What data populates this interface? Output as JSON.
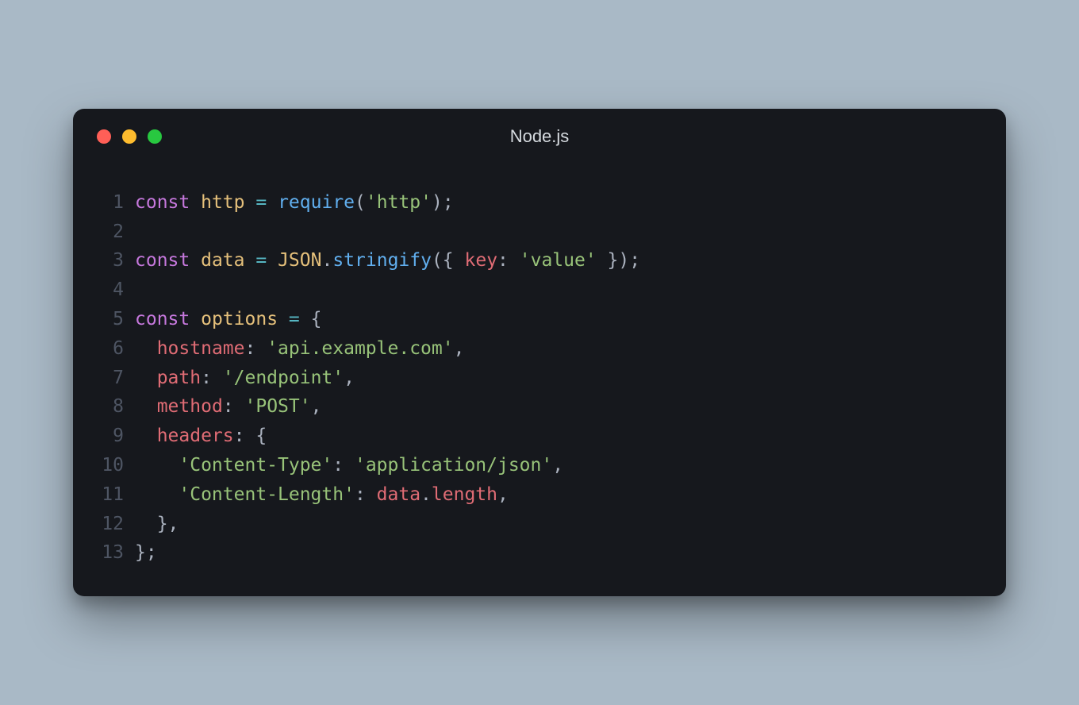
{
  "window": {
    "title": "Node.js",
    "traffic_lights": [
      "red",
      "yellow",
      "green"
    ]
  },
  "code": {
    "language": "javascript",
    "lines": [
      {
        "n": 1,
        "tokens": [
          [
            "kw",
            "const"
          ],
          [
            "punc",
            " "
          ],
          [
            "var",
            "http"
          ],
          [
            "punc",
            " "
          ],
          [
            "eq",
            "="
          ],
          [
            "punc",
            " "
          ],
          [
            "fn",
            "require"
          ],
          [
            "punc",
            "("
          ],
          [
            "str",
            "'http'"
          ],
          [
            "punc",
            ");"
          ]
        ]
      },
      {
        "n": 2,
        "tokens": []
      },
      {
        "n": 3,
        "tokens": [
          [
            "kw",
            "const"
          ],
          [
            "punc",
            " "
          ],
          [
            "var",
            "data"
          ],
          [
            "punc",
            " "
          ],
          [
            "eq",
            "="
          ],
          [
            "punc",
            " "
          ],
          [
            "obj",
            "JSON"
          ],
          [
            "punc",
            "."
          ],
          [
            "fn",
            "stringify"
          ],
          [
            "punc",
            "({ "
          ],
          [
            "prop",
            "key"
          ],
          [
            "punc",
            ": "
          ],
          [
            "str",
            "'value'"
          ],
          [
            "punc",
            " });"
          ]
        ]
      },
      {
        "n": 4,
        "tokens": []
      },
      {
        "n": 5,
        "tokens": [
          [
            "kw",
            "const"
          ],
          [
            "punc",
            " "
          ],
          [
            "var",
            "options"
          ],
          [
            "punc",
            " "
          ],
          [
            "eq",
            "="
          ],
          [
            "punc",
            " {"
          ]
        ]
      },
      {
        "n": 6,
        "tokens": [
          [
            "punc",
            "  "
          ],
          [
            "prop",
            "hostname"
          ],
          [
            "punc",
            ": "
          ],
          [
            "str",
            "'api.example.com'"
          ],
          [
            "punc",
            ","
          ]
        ]
      },
      {
        "n": 7,
        "tokens": [
          [
            "punc",
            "  "
          ],
          [
            "prop",
            "path"
          ],
          [
            "punc",
            ": "
          ],
          [
            "str",
            "'/endpoint'"
          ],
          [
            "punc",
            ","
          ]
        ]
      },
      {
        "n": 8,
        "tokens": [
          [
            "punc",
            "  "
          ],
          [
            "prop",
            "method"
          ],
          [
            "punc",
            ": "
          ],
          [
            "str",
            "'POST'"
          ],
          [
            "punc",
            ","
          ]
        ]
      },
      {
        "n": 9,
        "tokens": [
          [
            "punc",
            "  "
          ],
          [
            "prop",
            "headers"
          ],
          [
            "punc",
            ": {"
          ]
        ]
      },
      {
        "n": 10,
        "tokens": [
          [
            "punc",
            "    "
          ],
          [
            "str",
            "'Content-Type'"
          ],
          [
            "punc",
            ": "
          ],
          [
            "str",
            "'application/json'"
          ],
          [
            "punc",
            ","
          ]
        ]
      },
      {
        "n": 11,
        "tokens": [
          [
            "punc",
            "    "
          ],
          [
            "str",
            "'Content-Length'"
          ],
          [
            "punc",
            ": "
          ],
          [
            "id",
            "data"
          ],
          [
            "punc",
            "."
          ],
          [
            "id",
            "length"
          ],
          [
            "punc",
            ","
          ]
        ]
      },
      {
        "n": 12,
        "tokens": [
          [
            "punc",
            "  },"
          ]
        ]
      },
      {
        "n": 13,
        "tokens": [
          [
            "punc",
            "};"
          ]
        ]
      }
    ]
  }
}
